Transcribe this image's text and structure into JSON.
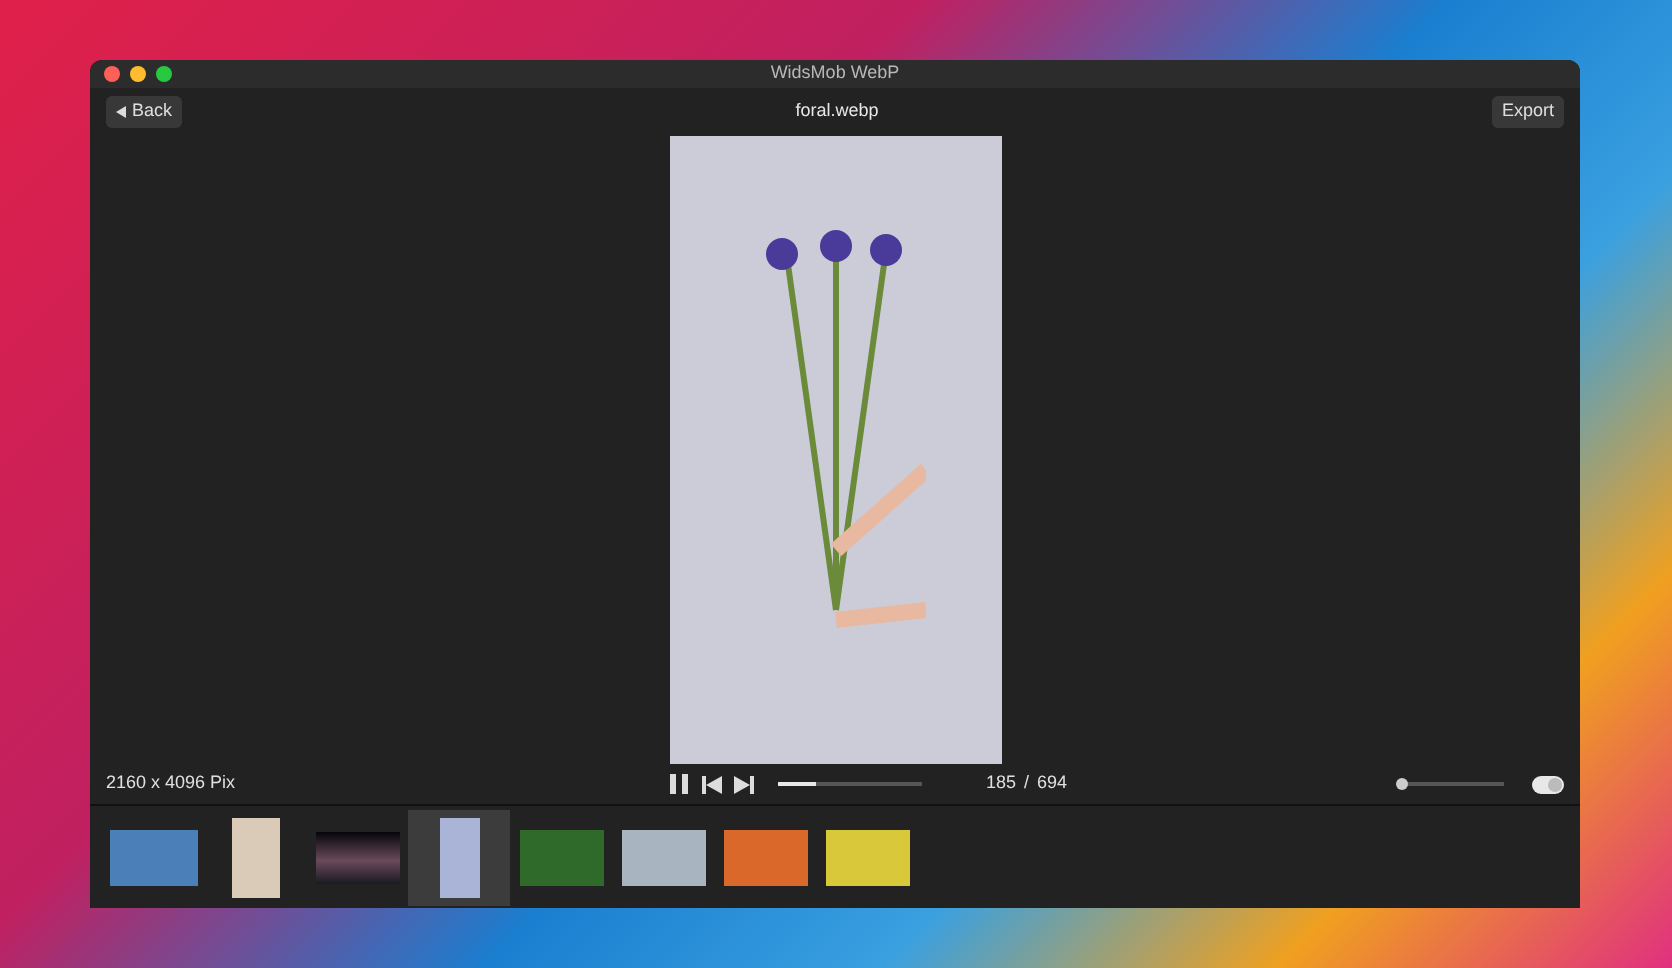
{
  "window": {
    "title": "WidsMob WebP"
  },
  "toolbar": {
    "back_button": "Back",
    "file_name": "foral.webp",
    "export_button": "Export"
  },
  "status": {
    "dimensions": "2160 x 4096 Pix"
  },
  "playback": {
    "playing": true,
    "level": 0.26,
    "frame": "185",
    "separator": "/",
    "total": "694"
  },
  "zoom": {
    "level": 0.02
  },
  "toggle": {
    "on": true
  },
  "thumbnails": [
    {
      "selected": false
    },
    {
      "selected": false
    },
    {
      "selected": false
    },
    {
      "selected": true
    },
    {
      "selected": false
    },
    {
      "selected": false
    },
    {
      "selected": false
    },
    {
      "selected": false
    }
  ]
}
